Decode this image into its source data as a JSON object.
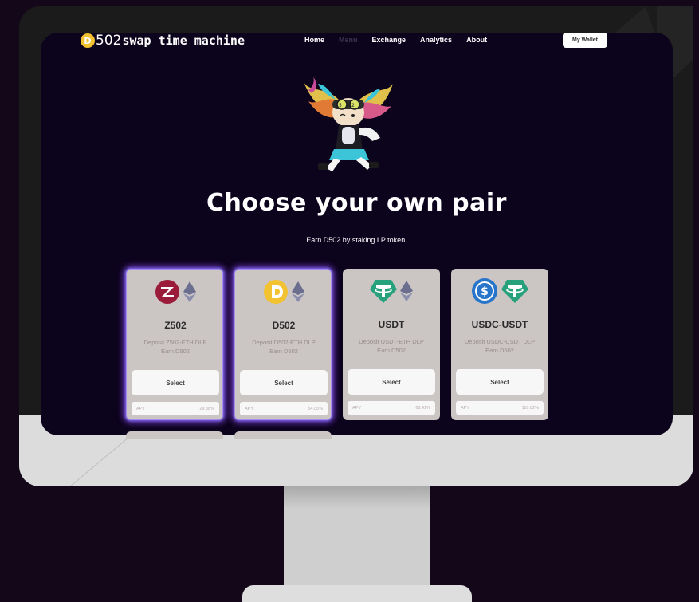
{
  "brand": {
    "coin_symbol": "D",
    "number": "502",
    "name": "swap time machine"
  },
  "nav": {
    "links": [
      {
        "label": "Home",
        "muted": false
      },
      {
        "label": "Menu",
        "muted": true
      },
      {
        "label": "Exchange",
        "muted": false
      },
      {
        "label": "Analytics",
        "muted": false
      },
      {
        "label": "About",
        "muted": false
      }
    ],
    "wallet_label": "My Wallet"
  },
  "hero": {
    "title": "Choose your own pair",
    "subtitle": "Earn D502 by staking LP token."
  },
  "cards": [
    {
      "title": "Z502",
      "desc_line1": "Deposit Z502-ETH DLP",
      "desc_line2": "Earn D502",
      "select_label": "Select",
      "apy_label": "APY",
      "apy_value": "29.38%",
      "icons": [
        "z502-token-icon",
        "ethereum-icon"
      ]
    },
    {
      "title": "D502",
      "desc_line1": "Deposit D502-ETH DLP",
      "desc_line2": "Earn D502",
      "select_label": "Select",
      "apy_label": "APY",
      "apy_value": "54.05%",
      "icons": [
        "d502-token-icon",
        "ethereum-icon"
      ]
    },
    {
      "title": "USDT",
      "desc_line1": "Deposit USDT-ETH DLP",
      "desc_line2": "Earn D502",
      "select_label": "Select",
      "apy_label": "APY",
      "apy_value": "68.41%",
      "icons": [
        "tether-icon",
        "ethereum-icon"
      ]
    },
    {
      "title": "USDC-USDT",
      "desc_line1": "Deposit USDC-USDT DLP",
      "desc_line2": "Earn D502",
      "select_label": "Select",
      "apy_label": "APY",
      "apy_value": "110.02%",
      "icons": [
        "usdc-icon",
        "tether-icon"
      ]
    }
  ],
  "colors": {
    "screen_bg": "#0c031d",
    "card_bg": "#cbc5c4",
    "glow": "#7b3fd8",
    "z502_red": "#9b1b3a",
    "d502_gold": "#f2c230",
    "tether_green": "#26a17b",
    "usdc_blue": "#2775ca",
    "eth_gray": "#6b6e8e"
  }
}
